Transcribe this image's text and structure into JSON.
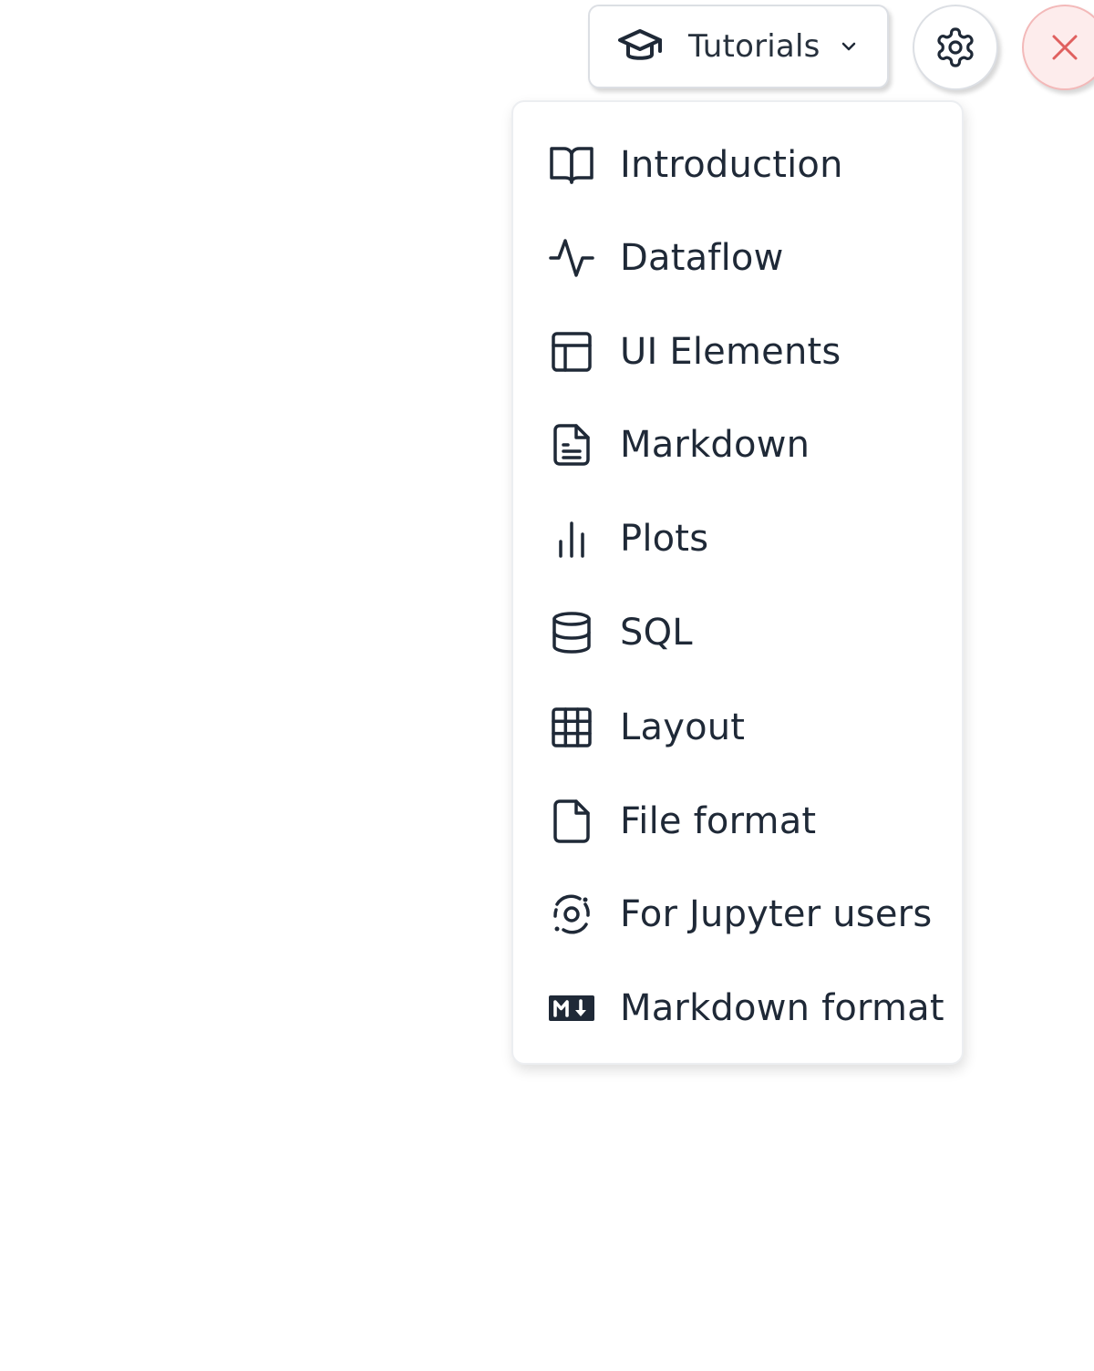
{
  "toolbar": {
    "tutorials_label": "Tutorials",
    "tutorials_icon": "graduation-cap-icon",
    "chevron_icon": "chevron-down-icon",
    "settings_icon": "gear-icon",
    "close_icon": "close-icon"
  },
  "colors": {
    "text": "#1f2937",
    "close_bg": "#fdecec",
    "close_border": "#f3b9b9",
    "close_icon": "#e0605f"
  },
  "menu": {
    "items": [
      {
        "label": "Introduction",
        "icon": "book-open-icon"
      },
      {
        "label": "Dataflow",
        "icon": "activity-icon"
      },
      {
        "label": "UI Elements",
        "icon": "layout-icon"
      },
      {
        "label": "Markdown",
        "icon": "file-text-icon"
      },
      {
        "label": "Plots",
        "icon": "bar-chart-icon"
      },
      {
        "label": "SQL",
        "icon": "database-icon"
      },
      {
        "label": "Layout",
        "icon": "grid-icon"
      },
      {
        "label": "File format",
        "icon": "file-icon"
      },
      {
        "label": "For Jupyter users",
        "icon": "jupyter-icon"
      },
      {
        "label": "Markdown format",
        "icon": "markdown-icon"
      }
    ]
  }
}
